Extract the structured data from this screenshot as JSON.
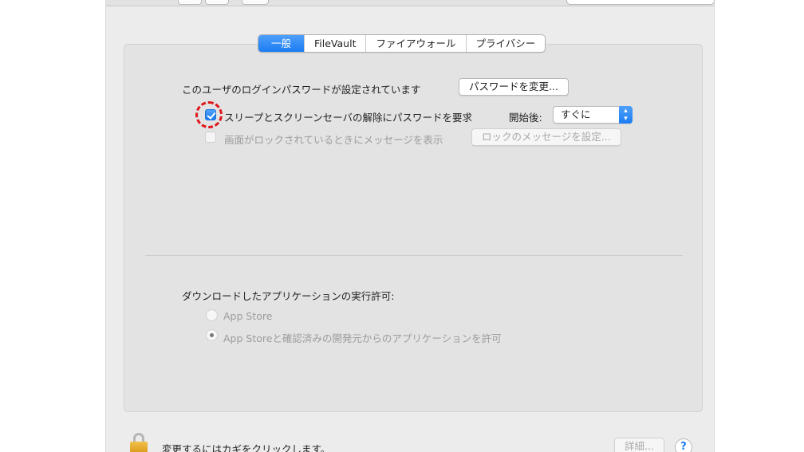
{
  "tabs": [
    {
      "label": "一般",
      "active": true
    },
    {
      "label": "FileVault",
      "active": false
    },
    {
      "label": "ファイアウォール",
      "active": false
    },
    {
      "label": "プライバシー",
      "active": false
    }
  ],
  "general": {
    "password_status": "このユーザのログインパスワードが設定されています",
    "change_password_button": "パスワードを変更...",
    "require_password_label": "スリープとスクリーンセーバの解除にパスワードを要求",
    "require_password_checked": true,
    "after_label": "開始後:",
    "after_value": "すぐに",
    "show_message_label": "画面がロックされているときにメッセージを表示",
    "show_message_checked": false,
    "set_lock_message_button": "ロックのメッセージを設定..."
  },
  "downloads": {
    "heading": "ダウンロードしたアプリケーションの実行許可:",
    "options": [
      {
        "label": "App Store",
        "selected": false
      },
      {
        "label": "App Storeと確認済みの開発元からのアプリケーションを許可",
        "selected": true
      }
    ]
  },
  "footer": {
    "lock_message": "変更するにはカギをクリックします。",
    "advanced_button": "詳細...",
    "help_button": "?"
  },
  "colors": {
    "accent": "#1b7cf2",
    "highlight": "#e0181e"
  }
}
